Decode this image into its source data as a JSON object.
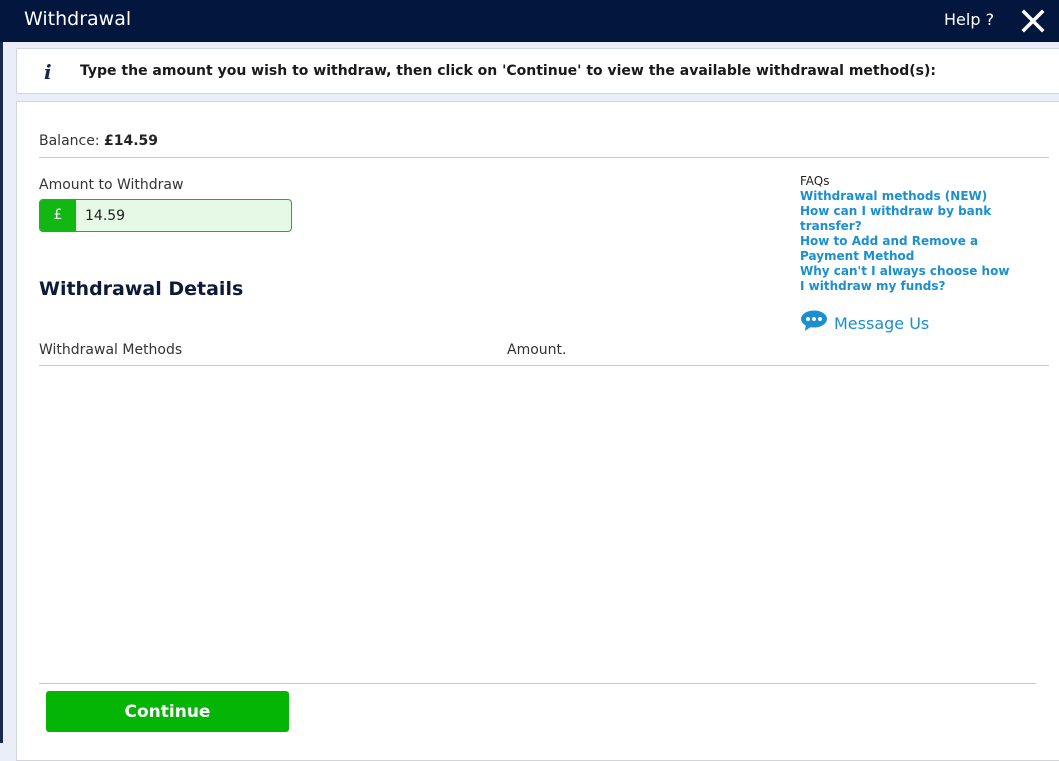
{
  "window": {
    "title": "Withdrawal",
    "help_label": "Help ?",
    "close_icon": "close-icon"
  },
  "info": {
    "icon": "info-icon",
    "icon_glyph": "i",
    "text": "Type the amount you wish to withdraw, then click on 'Continue' to view the available withdrawal method(s):"
  },
  "balance": {
    "label": "Balance:",
    "value": "£14.59"
  },
  "amount": {
    "label": "Amount to Withdraw",
    "currency_symbol": "£",
    "value": "14.59"
  },
  "details": {
    "title": "Withdrawal Details",
    "columns": [
      "Withdrawal Methods",
      "Amount."
    ],
    "rows": []
  },
  "faq": {
    "title": "FAQs",
    "links": [
      "Withdrawal methods (NEW)",
      "How can I withdraw by bank transfer?",
      "How to Add and Remove a Payment Method",
      "Why can't I always choose how I withdraw my funds?"
    ]
  },
  "message_us": {
    "icon": "chat-bubble-icon",
    "label": "Message Us"
  },
  "footer": {
    "continue_label": "Continue"
  },
  "colors": {
    "titlebar": "#03163e",
    "accent_green": "#05b505",
    "link_blue": "#1a8fd1"
  }
}
